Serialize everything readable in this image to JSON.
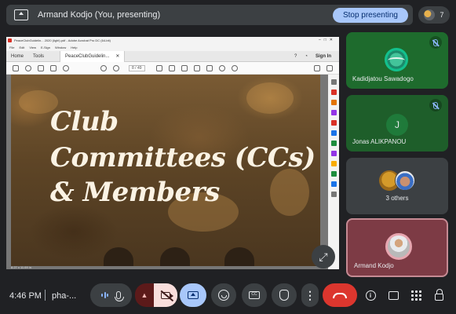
{
  "presenting_bar": {
    "title": "Armand Kodjo (You, presenting)",
    "stop_label": "Stop presenting"
  },
  "people_count": "7",
  "shared_screen": {
    "window_title": "PeaceClubGuidelin... 2020 (light).pdf - Adobe Acrobat Pro DC (64-bit)",
    "menu": [
      "File",
      "Edit",
      "View",
      "E-Sign",
      "Window",
      "Help"
    ],
    "tabs": [
      "Home",
      "Tools"
    ],
    "doc_tab": "PeaceClubGuidelin...",
    "sign_in": "Sign In",
    "page_indicator": "8 / 49",
    "heading_lines": [
      "Club",
      "Committees (CCs)",
      "& Members"
    ],
    "status_size": "8.27 x 11.69 in"
  },
  "participants": [
    {
      "name": "Kadidjatou Sawadogo",
      "muted": true
    },
    {
      "name": "Jonas ALIKPANOU",
      "initial": "J",
      "muted": true
    },
    {
      "name": "3 others"
    },
    {
      "name": "Armand Kodjo"
    }
  ],
  "bottom_bar": {
    "time": "4:46 PM",
    "meeting_code": "pha-..."
  },
  "colors": {
    "background": "#202124",
    "stop_button": "#a8c7fa",
    "camera_off": "#f9dedc",
    "present_active": "#a8c7fa",
    "hangup": "#dc362e",
    "self_tile": "#7d3b45"
  }
}
